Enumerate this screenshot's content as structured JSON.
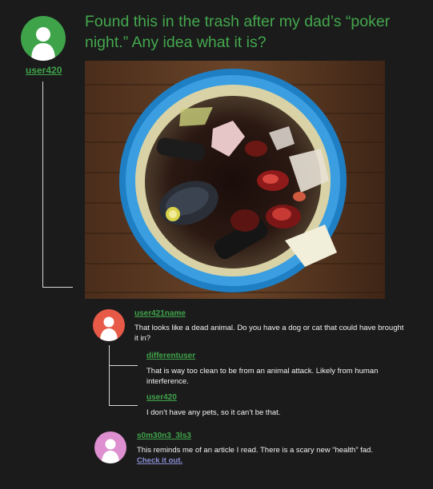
{
  "post": {
    "author": "user420",
    "title": "Found this in the trash after my dad’s “poker night.” Any idea what it is?",
    "avatar_color": "#3fa34a",
    "image_alt": "trash-can-photo"
  },
  "comments": [
    {
      "author": "user421name",
      "avatar_color": "#e85a48",
      "text": "That looks like a dead animal. Do you have a dog or cat that could have brought it in?",
      "replies": [
        {
          "author": "differentuser",
          "text": "That is way too clean to be from an animal attack. Likely from human interference."
        },
        {
          "author": "user420",
          "text": "I don’t have any pets, so it can’t be that."
        }
      ]
    },
    {
      "author": "s0m30n3_3ls3",
      "avatar_color": "#dd8fd0",
      "text": "This reminds me of an article I read. There is a scary new “health” fad.",
      "link_text": "Check it out."
    }
  ],
  "colors": {
    "background": "#1b1b1b",
    "accent_green": "#3fa34a",
    "link_purple": "#8a8fd4"
  }
}
